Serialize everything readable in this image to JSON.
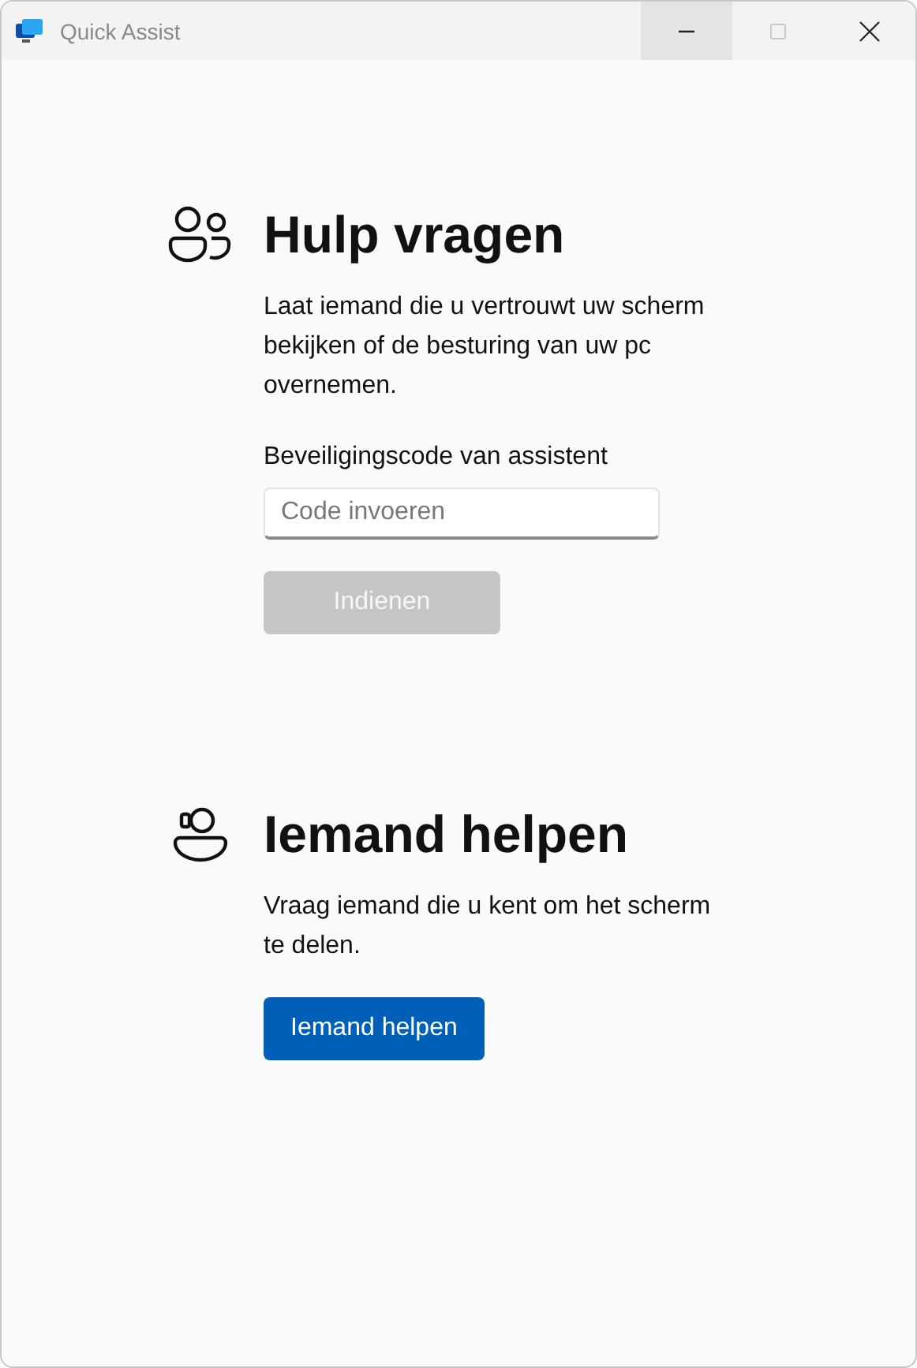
{
  "window": {
    "title": "Quick Assist",
    "controls": [
      {
        "kind": "minimize",
        "hovered": true,
        "disabled": false
      },
      {
        "kind": "maximize",
        "hovered": false,
        "disabled": true
      },
      {
        "kind": "close",
        "hovered": false,
        "disabled": false
      }
    ]
  },
  "sections": [
    {
      "kind": "request",
      "title": "Hulp vragen",
      "body": "Laat iemand die u vertrouwt uw scherm bekijken of de besturing van uw pc overnemen.",
      "field_label": "Beveiligingscode van assistent",
      "placeholder": "Code invoeren",
      "button": {
        "label": "Indienen",
        "disabled": true
      }
    },
    {
      "kind": "help",
      "title": "Iemand helpen",
      "body": "Vraag iemand die u kent om het scherm te delen.",
      "button": {
        "label": "Iemand helpen",
        "disabled": false
      }
    }
  ]
}
